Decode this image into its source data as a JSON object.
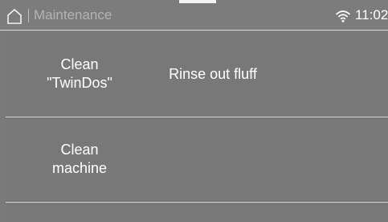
{
  "header": {
    "home_icon": "home-icon",
    "title": "Maintenance",
    "wifi_icon": "wifi-icon",
    "time": "11:02"
  },
  "items": [
    {
      "line1": "Clean",
      "line2": "\"TwinDos\""
    },
    {
      "label": "Rinse out fluff"
    },
    {
      "line1": "Clean",
      "line2": "machine"
    }
  ],
  "colors": {
    "background": "#7a7a7a",
    "divider": "#d2d2d2",
    "text": "#ffffff",
    "title_text": "#b3b3b3"
  }
}
